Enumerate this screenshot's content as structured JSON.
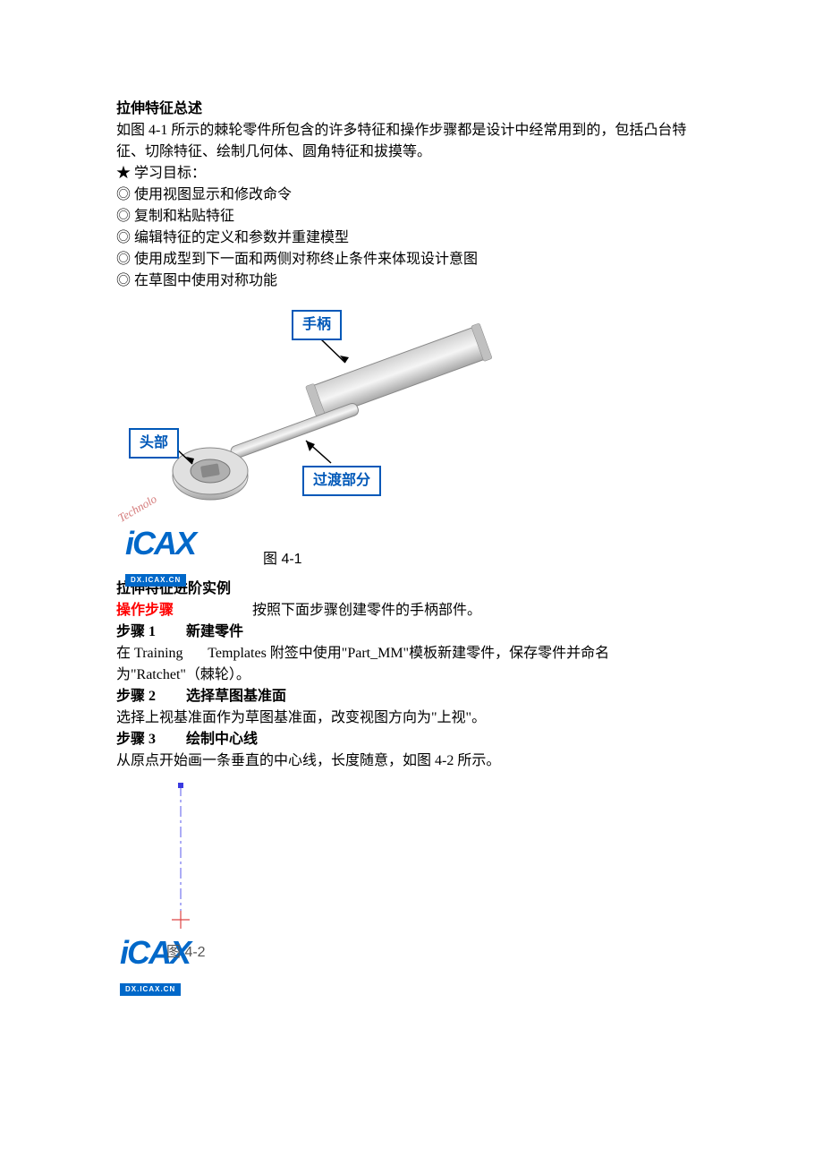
{
  "section1": {
    "title": "拉伸特征总述",
    "p1": "如图 4-1 所示的棘轮零件所包含的许多特征和操作步骤都是设计中经常用到的，包括凸台特征、切除特征、绘制几何体、圆角特征和拔摸等。",
    "objective_marker": "★ 学习目标：",
    "objectives": [
      "◎ 使用视图显示和修改命令",
      "◎ 复制和粘贴特征",
      "◎ 编辑特征的定义和参数并重建模型",
      "◎ 使用成型到下一面和两侧对称终止条件来体现设计意图",
      "◎ 在草图中使用对称功能"
    ]
  },
  "figure1": {
    "label_handle": "手柄",
    "label_head": "头部",
    "label_transition": "过渡部分",
    "caption": "图 4-1",
    "logo_main": "iCAX",
    "logo_sub": "DX.ICAX.CN",
    "logo_tech": "Technolo"
  },
  "section2": {
    "title": "拉伸特征进阶实例",
    "op_label": "操作步骤",
    "op_text": "按照下面步骤创建零件的手柄部件。",
    "step1": {
      "label": "步骤 1",
      "title": "新建零件",
      "text_a": "在 Training",
      "text_b": "Templates 附签中使用\"Part_MM\"模板新建零件，保存零件并命名为\"Ratchet\"（棘轮）。"
    },
    "step2": {
      "label": "步骤 2",
      "title": "选择草图基准面",
      "text": "选择上视基准面作为草图基准面，改变视图方向为\"上视\"。"
    },
    "step3": {
      "label": "步骤 3",
      "title": "绘制中心线",
      "text": "从原点开始画一条垂直的中心线，长度随意，如图 4-2 所示。"
    }
  },
  "figure2": {
    "caption": "图 4-2",
    "logo_main": "iCAX",
    "logo_sub": "DX.ICAX.CN"
  }
}
